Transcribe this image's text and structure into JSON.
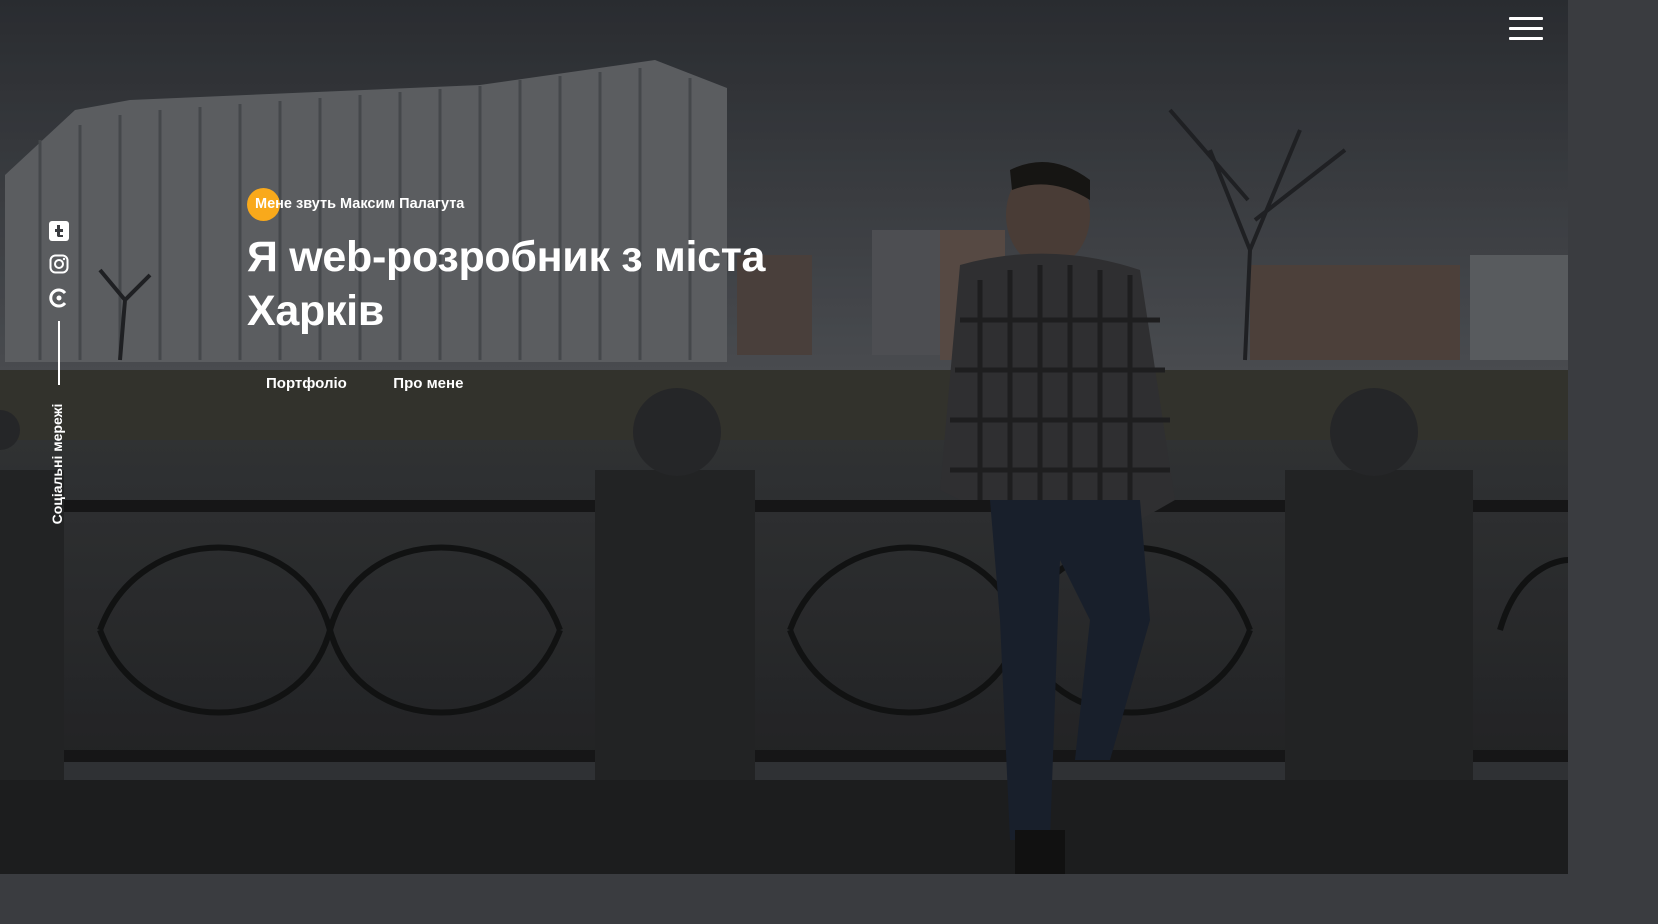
{
  "header": {
    "menu_icon": "hamburger-menu-icon"
  },
  "social": {
    "label": "Соціальні мережі",
    "icons": [
      "tumblr-icon",
      "instagram-icon",
      "codepen-icon"
    ]
  },
  "hero": {
    "intro": "Мене звуть Максим Палагута",
    "headline": "Я web-розробник з міста Харків",
    "accent_color": "#f9a91b"
  },
  "nav": {
    "portfolio_label": "Портфоліо",
    "about_label": "Про мене"
  }
}
